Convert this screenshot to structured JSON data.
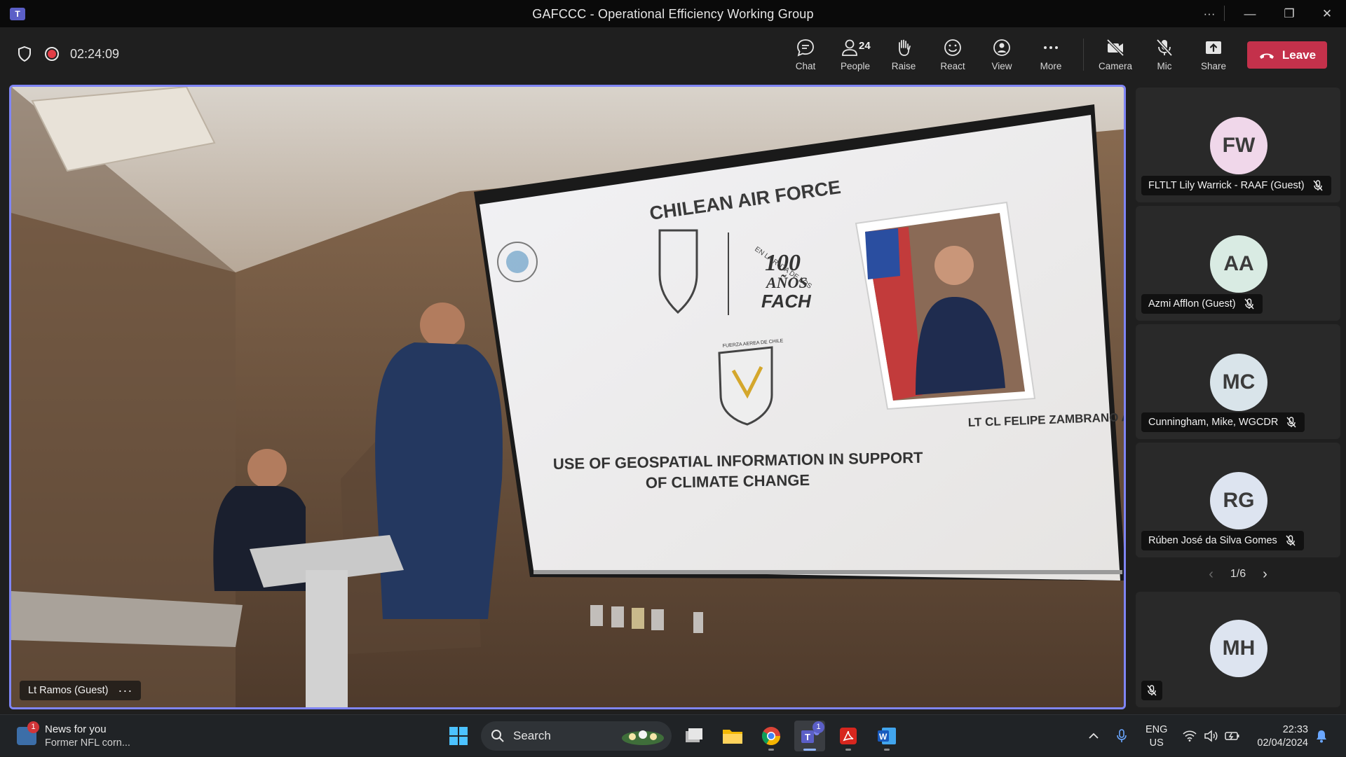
{
  "window": {
    "title": "GAFCCC - Operational Efficiency Working Group",
    "controls": [
      "more-options",
      "minimize",
      "restore",
      "close"
    ]
  },
  "meeting": {
    "elapsed": "02:24:09",
    "recording": true,
    "people_count": "24",
    "toolbar": {
      "chat": "Chat",
      "people": "People",
      "raise": "Raise",
      "react": "React",
      "view": "View",
      "more": "More",
      "camera": "Camera",
      "mic": "Mic",
      "share": "Share",
      "leave": "Leave"
    }
  },
  "stage": {
    "speaker_name": "Lt Ramos (Guest)",
    "slide": {
      "heading": "CHILEAN AIR FORCE",
      "anniversary": [
        "EN LA RUTA DE LOS",
        "100",
        "AÑOS",
        "FACH"
      ],
      "crest_label": "FUERZA AEREA DE CHILE",
      "caption": "LT CL FELIPE ZAMBRANO A.",
      "title_line1": "USE OF GEOSPATIAL INFORMATION IN SUPPORT",
      "title_line2": "OF CLIMATE CHANGE"
    }
  },
  "gallery": {
    "participants": [
      {
        "initials": "FW",
        "name": "FLTLT Lily Warrick - RAAF (Guest)",
        "avatar_color": "#f0d7ea",
        "muted": true
      },
      {
        "initials": "AA",
        "name": "Azmi Afflon (Guest)",
        "avatar_color": "#d9ebe3",
        "muted": true
      },
      {
        "initials": "MC",
        "name": "Cunningham, Mike, WGCDR",
        "avatar_color": "#d9e4ea",
        "muted": true
      },
      {
        "initials": "RG",
        "name": "Rúben José da Silva Gomes",
        "avatar_color": "#dde4f0",
        "muted": true
      },
      {
        "initials": "MH",
        "name": "",
        "avatar_color": "#dde4f0",
        "muted": true
      }
    ],
    "page": "1/6"
  },
  "taskbar": {
    "news_title": "News for you",
    "news_subtitle": "Former NFL corn...",
    "news_badge": "1",
    "search_placeholder": "Search",
    "teams_badge": "1",
    "language": "ENG",
    "region": "US",
    "time": "22:33",
    "date": "02/04/2024",
    "apps": [
      "windows-start",
      "search",
      "task-view",
      "file-explorer",
      "chrome",
      "teams",
      "acrobat",
      "word"
    ]
  },
  "colors": {
    "accent": "#7f85f5",
    "leave": "#c4314b",
    "recording": "#e23d46"
  }
}
